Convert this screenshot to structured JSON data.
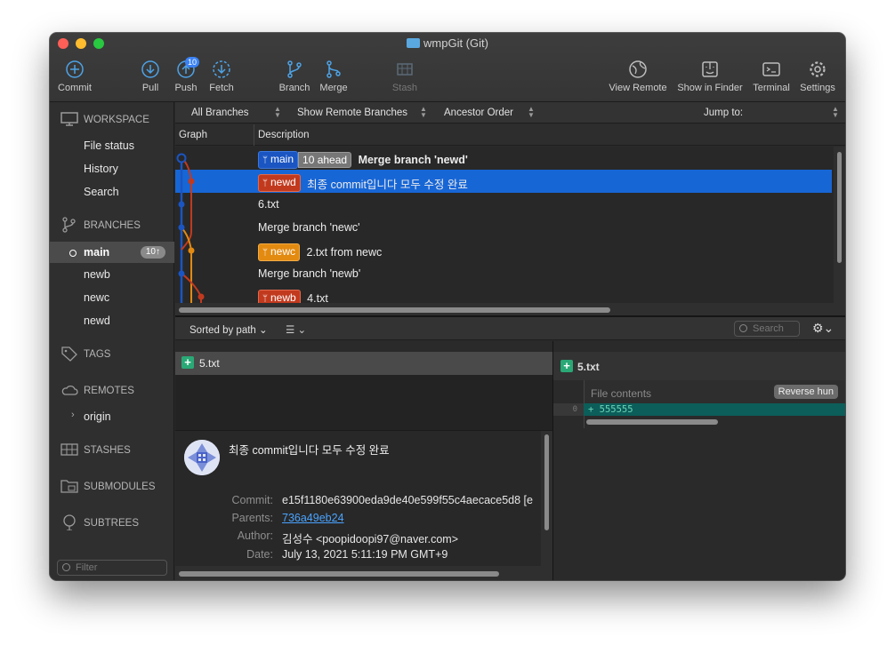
{
  "window": {
    "title": "wmpGit (Git)"
  },
  "toolbar": {
    "commit": "Commit",
    "pull": "Pull",
    "push": "Push",
    "push_badge": "10",
    "fetch": "Fetch",
    "branch": "Branch",
    "merge": "Merge",
    "stash": "Stash",
    "view_remote": "View Remote",
    "show_in_finder": "Show in Finder",
    "terminal": "Terminal",
    "settings": "Settings"
  },
  "sidebar": {
    "workspace": "WORKSPACE",
    "workspace_items": [
      "File status",
      "History",
      "Search"
    ],
    "branches": "BRANCHES",
    "branch_items": [
      {
        "name": "main",
        "badge": "10↑"
      },
      {
        "name": "newb"
      },
      {
        "name": "newc"
      },
      {
        "name": "newd"
      }
    ],
    "tags": "TAGS",
    "remotes": "REMOTES",
    "remote_items": [
      "origin"
    ],
    "stashes": "STASHES",
    "submodules": "SUBMODULES",
    "subtrees": "SUBTREES",
    "filter_placeholder": "Filter"
  },
  "filters": {
    "branches": "All Branches",
    "remote": "Show Remote Branches",
    "order": "Ancestor Order",
    "jump": "Jump to:"
  },
  "columns": {
    "graph": "Graph",
    "description": "Description"
  },
  "commits": [
    {
      "tags": [
        {
          "text": "main",
          "style": "main"
        },
        {
          "text": "10 ahead",
          "style": "ahead"
        }
      ],
      "message": "Merge branch 'newd'",
      "bold": true
    },
    {
      "tags": [
        {
          "text": "newd",
          "style": "red"
        }
      ],
      "message": "최종 commit입니다 모두 수정 완료",
      "selected": true
    },
    {
      "tags": [],
      "message": "6.txt"
    },
    {
      "tags": [],
      "message": "Merge branch 'newc'"
    },
    {
      "tags": [
        {
          "text": "newc",
          "style": "orange"
        }
      ],
      "message": "2.txt from newc"
    },
    {
      "tags": [],
      "message": "Merge branch 'newb'"
    },
    {
      "tags": [
        {
          "text": "newb",
          "style": "red"
        }
      ],
      "message": "4.txt"
    }
  ],
  "lower": {
    "sort": "Sorted by path",
    "search_placeholder": "Search",
    "files": [
      "5.txt"
    ]
  },
  "details": {
    "message": "최종 commit입니다 모두 수정 완료",
    "commit_label": "Commit:",
    "commit": "e15f1180e63900eda9de40e599f55c4aecace5d8 [e",
    "parents_label": "Parents:",
    "parents": "736a49eb24",
    "author_label": "Author:",
    "author": "김성수 <poopidoopi97@naver.com>",
    "date_label": "Date:",
    "date": "July 13, 2021 5:11:19 PM GMT+9"
  },
  "diff": {
    "file": "5.txt",
    "hunk_header": "File contents",
    "reverse_button": "Reverse hun",
    "line_number": "0",
    "added_line": "+ 555555"
  },
  "colors": {
    "selection": "#1766d6",
    "main_branch": "#1a55c2",
    "newd_branch": "#c23a1e",
    "newc_branch": "#e38a11",
    "add_line": "#0c5e5a"
  }
}
